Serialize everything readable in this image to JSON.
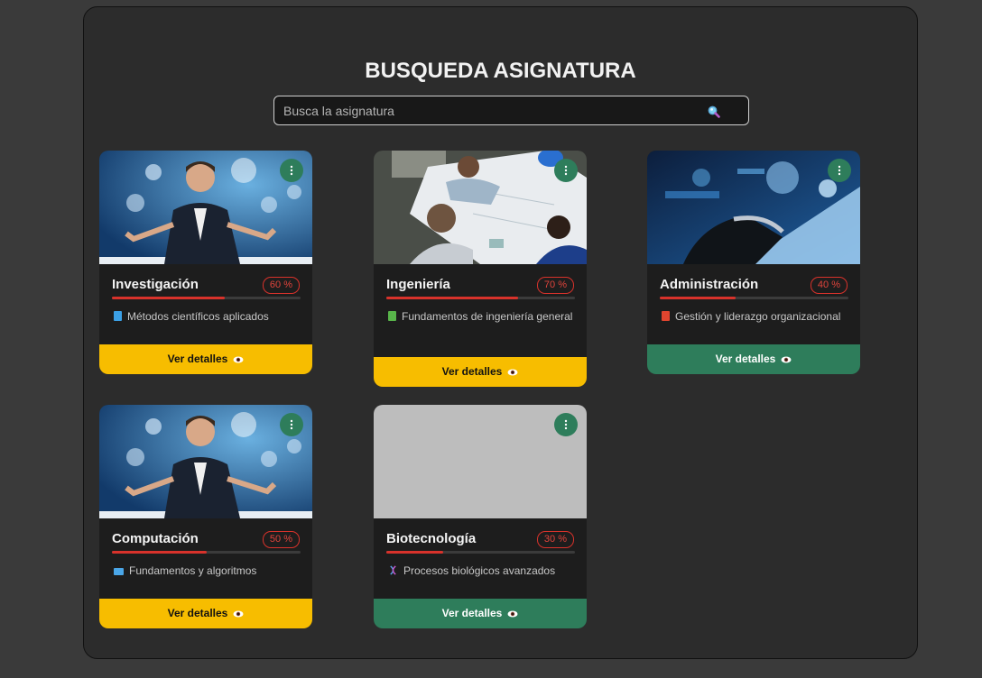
{
  "page": {
    "title": "BUSQUEDA ASIGNATURA"
  },
  "search": {
    "placeholder": "Busca la asignatura",
    "value": "",
    "icon": "search-icon"
  },
  "colors": {
    "accent_yellow": "#f7bd00",
    "accent_green": "#2e7d5b",
    "progress_red": "#d8322b"
  },
  "cards": [
    {
      "name": "Investigación",
      "percent": "60 %",
      "progress": 0.6,
      "description": "Métodos científicos aplicados",
      "icon": "blue-book-icon",
      "button_label": "Ver detalles",
      "button_style": "yellow",
      "image": "businessman-network"
    },
    {
      "name": "Ingeniería",
      "percent": "70 %",
      "progress": 0.7,
      "description": "Fundamentos de ingeniería general",
      "icon": "green-book-icon",
      "button_label": "Ver detalles",
      "button_style": "yellow",
      "image": "engineers-blueprint"
    },
    {
      "name": "Administración",
      "percent": "40 %",
      "progress": 0.4,
      "description": "Gestión y liderazgo organizacional",
      "icon": "red-book-icon",
      "button_label": "Ver detalles",
      "button_style": "green",
      "image": "laptop-hands"
    },
    {
      "name": "Computación",
      "percent": "50 %",
      "progress": 0.5,
      "description": "Fundamentos y algoritmos",
      "icon": "computer-icon",
      "button_label": "Ver detalles",
      "button_style": "yellow",
      "image": "businessman-network"
    },
    {
      "name": "Biotecnología",
      "percent": "30 %",
      "progress": 0.3,
      "description": "Procesos biológicos avanzados",
      "icon": "dna-icon",
      "button_label": "Ver detalles",
      "button_style": "green",
      "image": "placeholder-gray"
    }
  ]
}
